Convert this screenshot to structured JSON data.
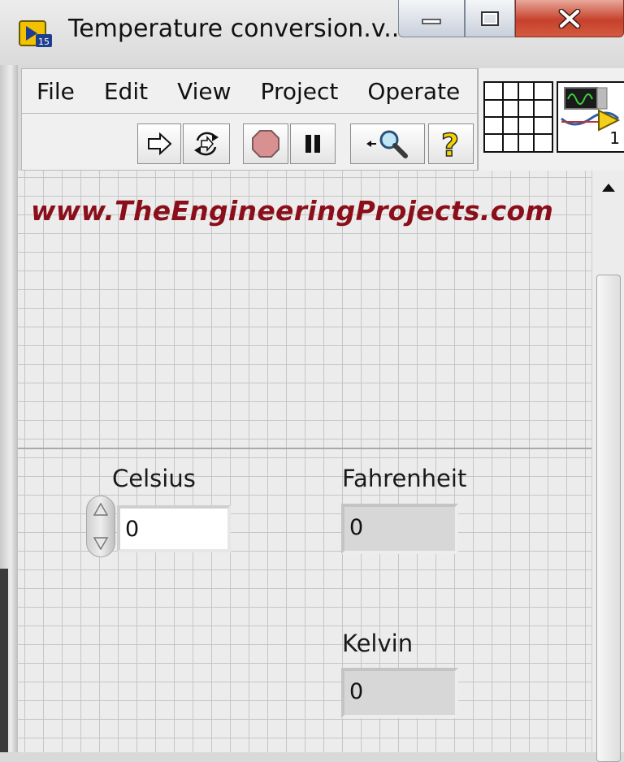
{
  "window": {
    "title": "Temperature conversion.v...",
    "icon": "labview-vi-icon",
    "controls": [
      "minimize-icon",
      "maximize-icon",
      "close-icon"
    ]
  },
  "menu": {
    "items": [
      "File",
      "Edit",
      "View",
      "Project",
      "Operate"
    ]
  },
  "toolbar": {
    "buttons": [
      "run-arrow-icon",
      "run-continuously-icon",
      "abort-icon",
      "pause-icon",
      "highlight-execution-icon",
      "context-help-icon"
    ]
  },
  "vi_icon": {
    "number": "1"
  },
  "panel": {
    "watermark": "www.TheEngineeringProjects.com",
    "celsius": {
      "label": "Celsius",
      "value": "0"
    },
    "fahrenheit": {
      "label": "Fahrenheit",
      "value": "0"
    },
    "kelvin": {
      "label": "Kelvin",
      "value": "0"
    }
  },
  "colors": {
    "watermark": "#8b0f1a",
    "close_button": "#c7412c",
    "panel_background": "#ececec"
  }
}
